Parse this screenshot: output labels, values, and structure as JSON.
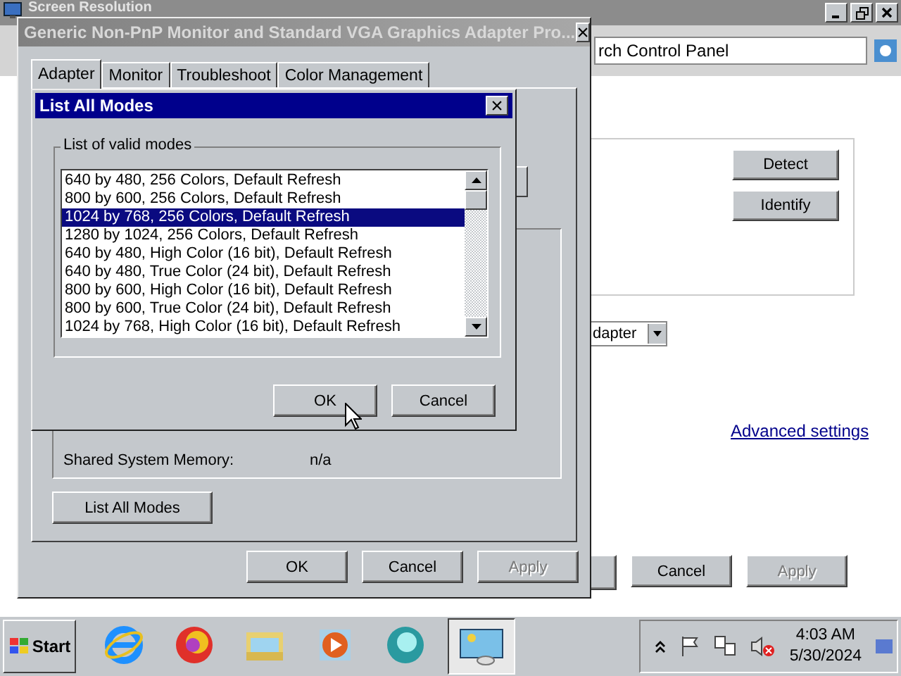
{
  "background_window": {
    "title": "Screen Resolution",
    "address": "rch Control Panel",
    "buttons": [
      {
        "label": "Detect"
      },
      {
        "label": "Identify"
      }
    ],
    "dropdown": "dapter",
    "link": "Advanced settings",
    "footer_buttons": [
      {
        "label": "Cancel",
        "disabled": false
      },
      {
        "label": "Apply",
        "disabled": true
      }
    ]
  },
  "properties_dialog": {
    "title": "Generic Non-PnP Monitor and Standard VGA Graphics Adapter Pro...",
    "close": "×",
    "tabs": [
      {
        "label": "Adapter",
        "selected": true
      },
      {
        "label": "Monitor",
        "selected": false
      },
      {
        "label": "Troubleshoot",
        "selected": false
      },
      {
        "label": "Color Management",
        "selected": false
      }
    ],
    "info": [
      {
        "label": "Shared System Memory:",
        "value": "n/a"
      }
    ],
    "list_all_modes_button": "List All Modes",
    "buttons": [
      {
        "label": "OK",
        "disabled": false
      },
      {
        "label": "Cancel",
        "disabled": false
      },
      {
        "label": "Apply",
        "disabled": true
      }
    ]
  },
  "modes_dialog": {
    "title": "List All Modes",
    "close": "×",
    "group_label": "List of valid modes",
    "modes": [
      {
        "label": "640 by 480, 256 Colors, Default Refresh",
        "selected": false
      },
      {
        "label": "800 by 600, 256 Colors, Default Refresh",
        "selected": false
      },
      {
        "label": "1024 by 768, 256 Colors, Default Refresh",
        "selected": true
      },
      {
        "label": "1280 by 1024, 256 Colors, Default Refresh",
        "selected": false
      },
      {
        "label": "640 by 480, High Color (16 bit), Default Refresh",
        "selected": false
      },
      {
        "label": "640 by 480, True Color (24 bit), Default Refresh",
        "selected": false
      },
      {
        "label": "800 by 600, High Color (16 bit), Default Refresh",
        "selected": false
      },
      {
        "label": "800 by 600, True Color (24 bit), Default Refresh",
        "selected": false
      },
      {
        "label": "1024 by 768, High Color (16 bit), Default Refresh",
        "selected": false
      }
    ],
    "buttons": [
      {
        "label": "OK"
      },
      {
        "label": "Cancel"
      }
    ]
  },
  "taskbar": {
    "start": "Start",
    "apps": [
      {
        "kind": "browser-e",
        "active": false
      },
      {
        "kind": "fox",
        "active": false
      },
      {
        "kind": "folder",
        "active": false
      },
      {
        "kind": "media",
        "active": false
      },
      {
        "kind": "ring",
        "active": false
      },
      {
        "kind": "display",
        "active": true
      }
    ],
    "time": "4:03 AM",
    "date": "5/30/2024"
  }
}
